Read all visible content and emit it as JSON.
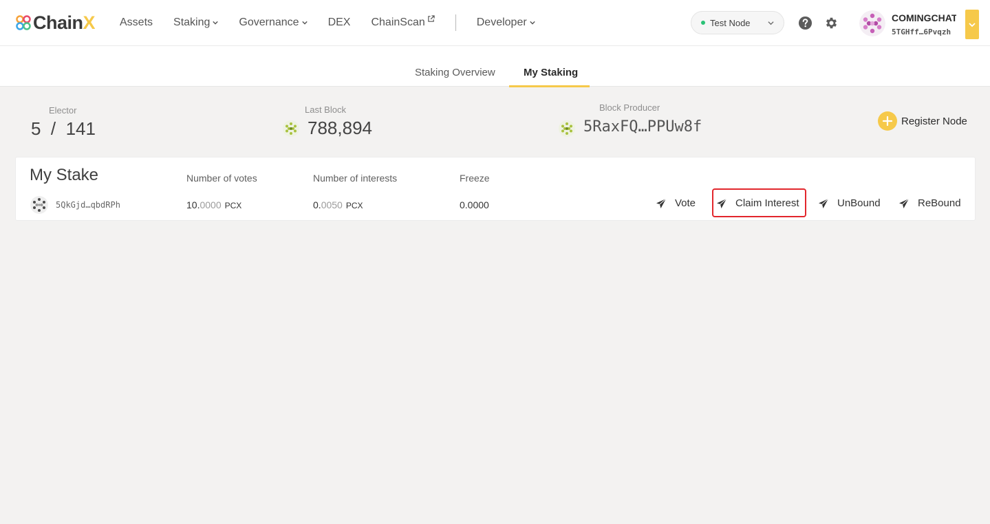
{
  "header": {
    "logo_text_main": "Chain",
    "logo_text_accent": "X",
    "nav": [
      {
        "label": "Assets"
      },
      {
        "label": "Staking"
      },
      {
        "label": "Governance"
      },
      {
        "label": "DEX"
      },
      {
        "label": "ChainScan"
      },
      {
        "label": "Developer"
      }
    ],
    "node_select": {
      "value": "Test Node",
      "status_color": "#2ac277"
    },
    "account": {
      "name": "COMINGCHAT",
      "address": "5TGHff…6Pvqzh"
    }
  },
  "tabs": [
    {
      "label": "Staking Overview",
      "active": false
    },
    {
      "label": "My Staking",
      "active": true
    }
  ],
  "stats": {
    "elector": {
      "label": "Elector",
      "value": "5  /  141"
    },
    "last_block": {
      "label": "Last Block",
      "value": "788,894"
    },
    "block_producer": {
      "label": "Block Producer",
      "value": "5RaxFQ…PPUw8f"
    }
  },
  "register_node": {
    "label": "Register Node"
  },
  "my_stake": {
    "title": "My Stake",
    "columns": [
      "Number of votes",
      "Number of interests",
      "Freeze"
    ],
    "row": {
      "address": "5QkGjd…qbdRPh",
      "votes_int": "10.",
      "votes_dec": "0000",
      "votes_unit": "PCX",
      "interests_int": "0.",
      "interests_dec": "0050",
      "interests_unit": "PCX",
      "freeze": "0.0000"
    },
    "actions": [
      {
        "label": "Vote"
      },
      {
        "label": "Claim Interest",
        "highlighted": true
      },
      {
        "label": "UnBound"
      },
      {
        "label": "ReBound"
      }
    ]
  },
  "colors": {
    "accent": "#f6c94a",
    "highlight": "#e2262c",
    "background": "#f3f2f1"
  }
}
